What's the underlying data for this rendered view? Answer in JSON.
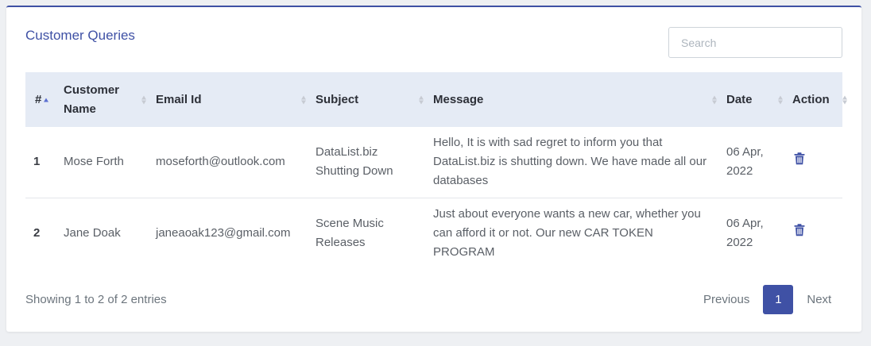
{
  "card": {
    "title": "Customer Queries",
    "search_placeholder": "Search"
  },
  "table": {
    "columns": [
      {
        "label": "#"
      },
      {
        "label": "Customer Name"
      },
      {
        "label": "Email Id"
      },
      {
        "label": "Subject"
      },
      {
        "label": "Message"
      },
      {
        "label": "Date"
      },
      {
        "label": "Action"
      }
    ],
    "sorted_column": "#",
    "sort_direction": "ascending",
    "rows": [
      {
        "num": "1",
        "name": "Mose Forth",
        "email": "moseforth@outlook.com",
        "subject": "DataList.biz Shutting Down",
        "message": "Hello, It is with sad regret to inform you that DataList.biz is shutting down. We have made all our databases",
        "date": "06 Apr, 2022",
        "action_icon": "trash-icon"
      },
      {
        "num": "2",
        "name": "Jane Doak",
        "email": "janeaoak123@gmail.com",
        "subject": "Scene Music Releases",
        "message": "Just about everyone wants a new car, whether you can afford it or not. Our new CAR TOKEN PROGRAM",
        "date": "06 Apr, 2022",
        "action_icon": "trash-icon"
      }
    ]
  },
  "footer": {
    "info": "Showing 1 to 2 of 2 entries",
    "previous": "Previous",
    "current_page": "1",
    "next": "Next"
  },
  "colors": {
    "accent": "#3f51a5",
    "header_bg": "#e5ebf5"
  }
}
